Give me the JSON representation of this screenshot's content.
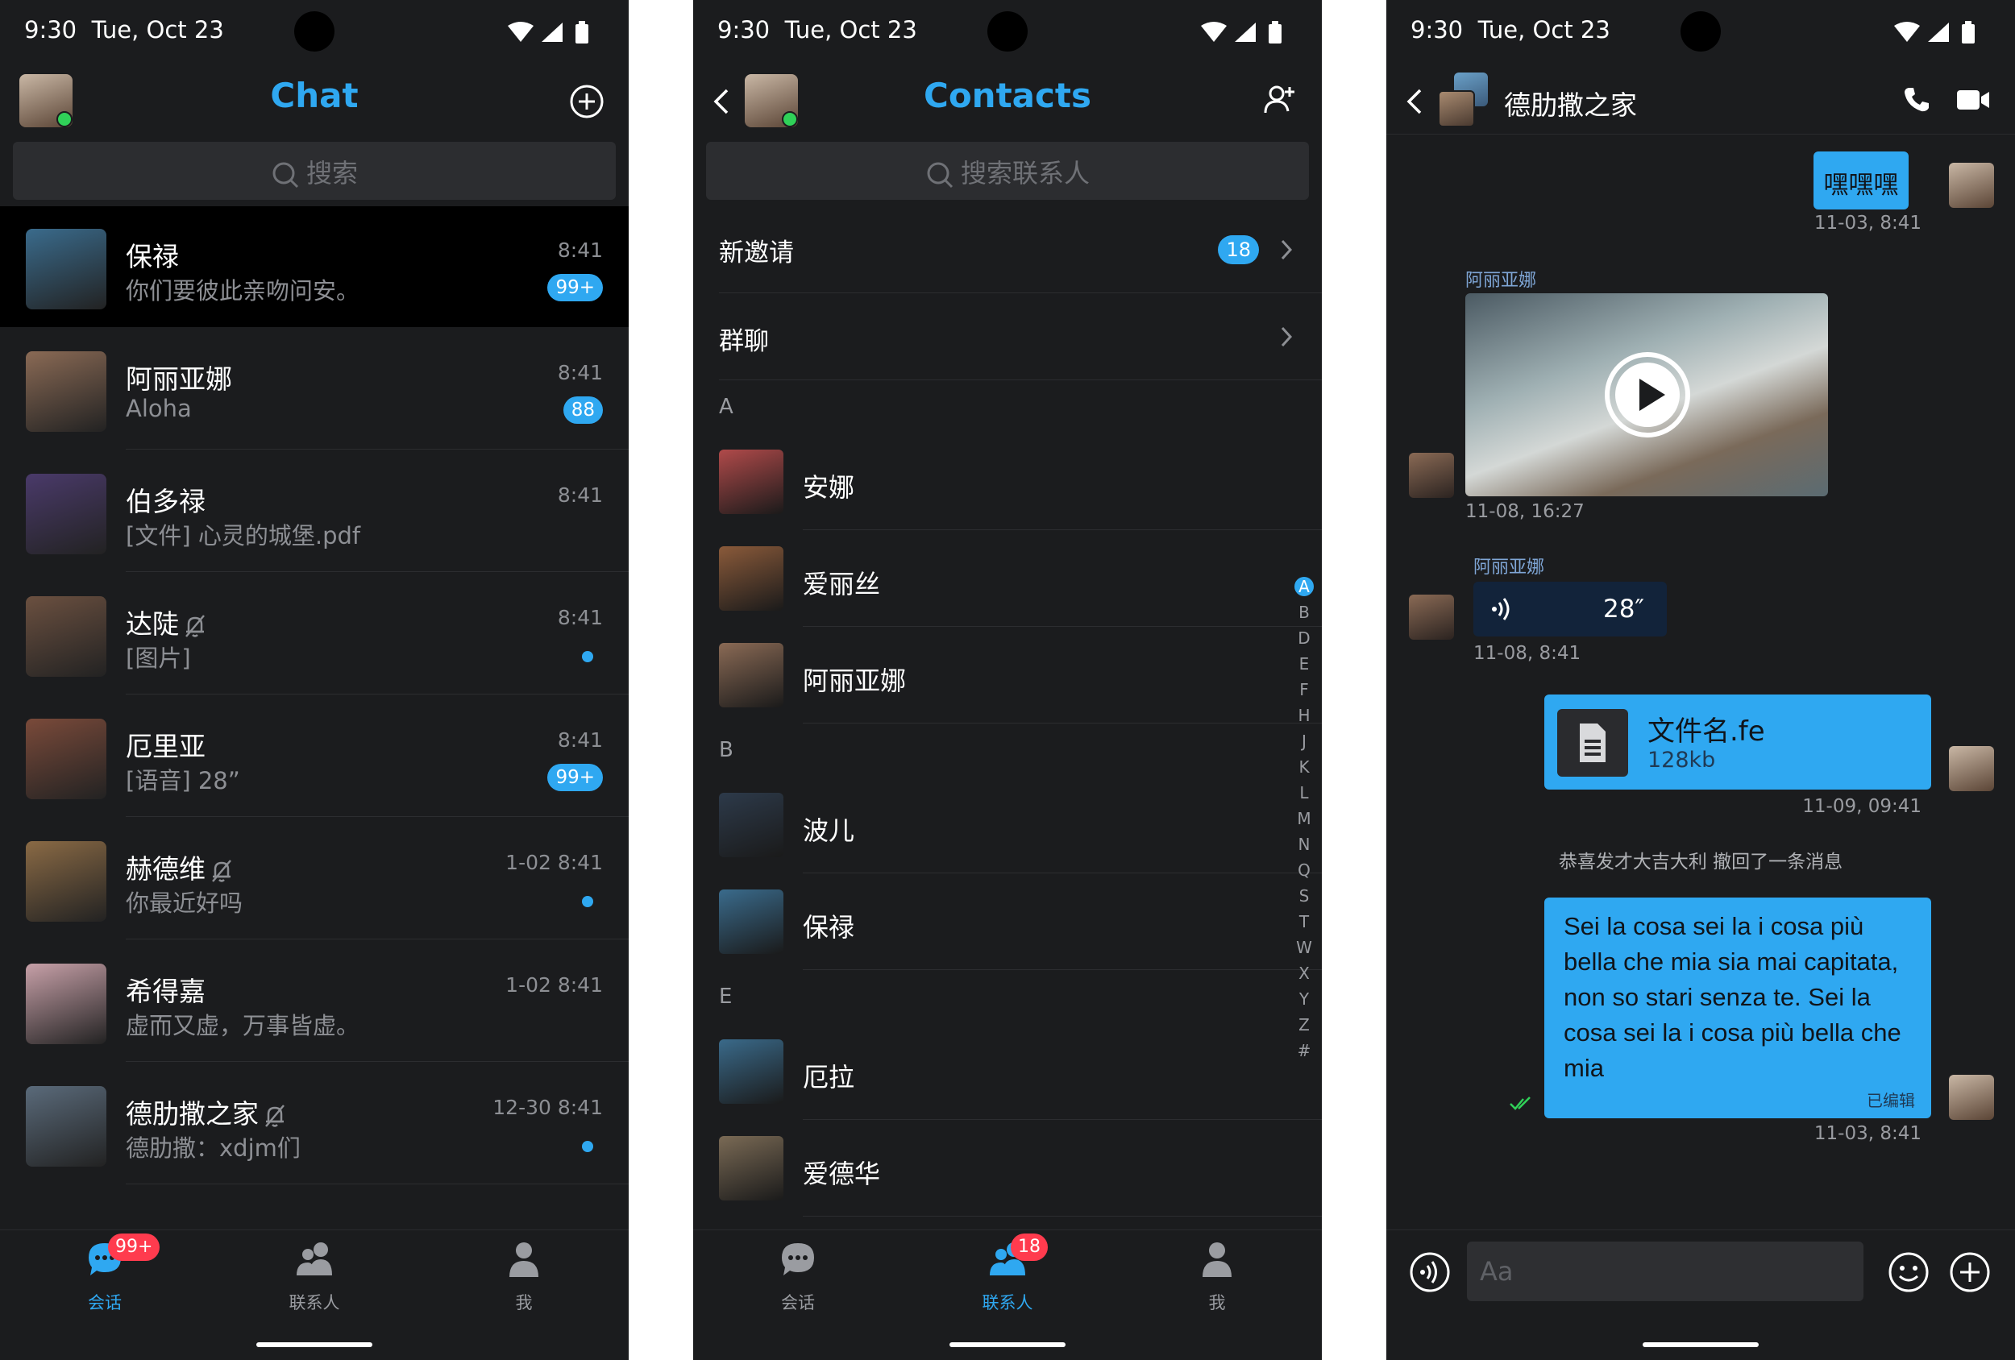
{
  "status": {
    "time": "9:30",
    "date": "Tue, Oct 23"
  },
  "chat": {
    "title": "Chat",
    "search_placeholder": "搜索",
    "conversations": [
      {
        "name": "保禄",
        "preview": "你们要彼此亲吻问安。",
        "time": "8:41",
        "badge": "99+",
        "muted": false,
        "avatar_color": "#3a6b8c"
      },
      {
        "name": "阿丽亚娜",
        "preview": "Aloha",
        "time": "8:41",
        "badge": "88",
        "muted": false,
        "avatar_color": "#8a6a55"
      },
      {
        "name": "伯多禄",
        "preview": "[文件] 心灵的城堡.pdf",
        "time": "8:41",
        "badge": "",
        "muted": false,
        "avatar_color": "#4a3a6a"
      },
      {
        "name": "达陡",
        "preview": "[图片]",
        "time": "8:41",
        "badge": "",
        "muted": true,
        "avatar_color": "#6b5040"
      },
      {
        "name": "厄里亚",
        "preview": "[语音] 28”",
        "time": "8:41",
        "badge": "99+",
        "muted": false,
        "avatar_color": "#7a4a3a"
      },
      {
        "name": "赫德维",
        "preview": "你最近好吗",
        "time": "1-02 8:41",
        "badge": "",
        "muted": true,
        "avatar_color": "#8a6a45"
      },
      {
        "name": "希得嘉",
        "preview": "虚而又虚，万事皆虚。",
        "time": "1-02 8:41",
        "badge": "",
        "muted": false,
        "avatar_color": "#c7a0a8"
      },
      {
        "name": "德肋撒之家",
        "preview": "德肋撒：xdjm们",
        "time": "12-30 8:41",
        "badge": "",
        "muted": true,
        "avatar_color": "#5a6a7a"
      }
    ],
    "tabs": [
      {
        "label": "会话",
        "badge": "99+",
        "icon": "chat-bubble-icon"
      },
      {
        "label": "联系人",
        "badge": "",
        "icon": "contacts-icon"
      },
      {
        "label": "我",
        "badge": "",
        "icon": "person-icon"
      }
    ]
  },
  "contacts": {
    "title": "Contacts",
    "search_placeholder": "搜索联系人",
    "new_invites_label": "新邀请",
    "new_invites_count": "18",
    "groups_label": "群聊",
    "sections": [
      {
        "letter": "A",
        "names": [
          "安娜",
          "爱丽丝",
          "阿丽亚娜"
        ]
      },
      {
        "letter": "B",
        "names": [
          "波儿",
          "保禄"
        ]
      },
      {
        "letter": "E",
        "names": [
          "厄拉",
          "爱德华"
        ]
      }
    ],
    "index_letters": [
      "A",
      "B",
      "D",
      "E",
      "F",
      "H",
      "J",
      "K",
      "L",
      "M",
      "N",
      "Q",
      "S",
      "T",
      "W",
      "X",
      "Y",
      "Z",
      "#"
    ],
    "tabs": [
      {
        "label": "会话",
        "badge": "",
        "icon": "chat-bubble-icon"
      },
      {
        "label": "联系人",
        "badge": "18",
        "icon": "contacts-icon"
      },
      {
        "label": "我",
        "badge": "",
        "icon": "person-icon"
      }
    ]
  },
  "conversation": {
    "title": "德肋撒之家",
    "messages": {
      "m1_text": "嘿嘿嘿",
      "m1_time": "11-03, 8:41",
      "m2_sender": "阿丽亚娜",
      "m2_time": "11-08, 16:27",
      "m3_sender": "阿丽亚娜",
      "m3_duration": "28″",
      "m3_time": "11-08, 8:41",
      "m4_filename": "文件名.fe",
      "m4_size": "128kb",
      "m4_time": "11-09, 09:41",
      "recall_notice": "恭喜发才大吉大利 撤回了一条消息",
      "m5_text": "Sei la cosa sei la i cosa più bella che mia sia mai capitata, non so stari senza te. Sei la cosa sei la i cosa più bella che mia",
      "m5_edited": "已编辑",
      "m5_time": "11-03, 8:41"
    },
    "input_placeholder": "Aa"
  },
  "colors": {
    "accent": "#2fa8f1",
    "background": "#1b1c1e",
    "badge_red": "#ff3b4e",
    "online": "#30d158"
  }
}
